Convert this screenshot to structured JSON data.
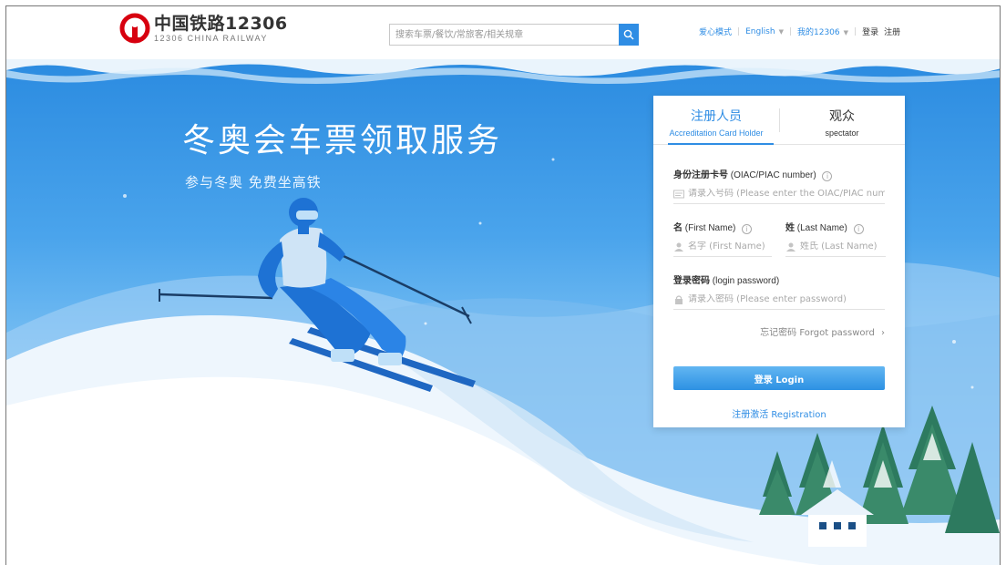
{
  "header": {
    "logo_cn": "中国铁路12306",
    "logo_en": "12306 CHINA RAILWAY",
    "search_placeholder": "搜索车票/餐饮/常旅客/相关规章",
    "nav": {
      "care_mode": "爱心模式",
      "language": "English",
      "my12306": "我的12306",
      "login": "登录",
      "register": "注册"
    }
  },
  "hero": {
    "title": "冬奥会车票领取服务",
    "subtitle": "参与冬奥 免费坐高铁"
  },
  "login_card": {
    "tabs": [
      {
        "cn": "注册人员",
        "en": "Accreditation Card Holder",
        "active": true
      },
      {
        "cn": "观众",
        "en": "spectator",
        "active": false
      }
    ],
    "id_label_cn": "身份注册卡号",
    "id_label_en": "(OIAC/PIAC number)",
    "id_placeholder": "请录入号码 (Please enter the OIAC/PIAC number)",
    "first_name_label_cn": "名",
    "first_name_label_en": "(First Name)",
    "first_name_placeholder": "名字 (First Name)",
    "last_name_label_cn": "姓",
    "last_name_label_en": "(Last Name)",
    "last_name_placeholder": "姓氏 (Last Name)",
    "password_label_cn": "登录密码",
    "password_label_en": "(login password)",
    "password_placeholder": "请录入密码 (Please enter password)",
    "forgot": "忘记密码 Forgot password",
    "login_button": "登录  Login",
    "register_link": "注册激活 Registration"
  },
  "colors": {
    "brand_red": "#d7000f",
    "accent_blue": "#2f8de4"
  },
  "icons": [
    "railway-logo-icon",
    "search-icon",
    "info-icon",
    "card-icon",
    "user-icon",
    "lock-icon",
    "chevron-right-icon",
    "chevron-down-icon"
  ]
}
